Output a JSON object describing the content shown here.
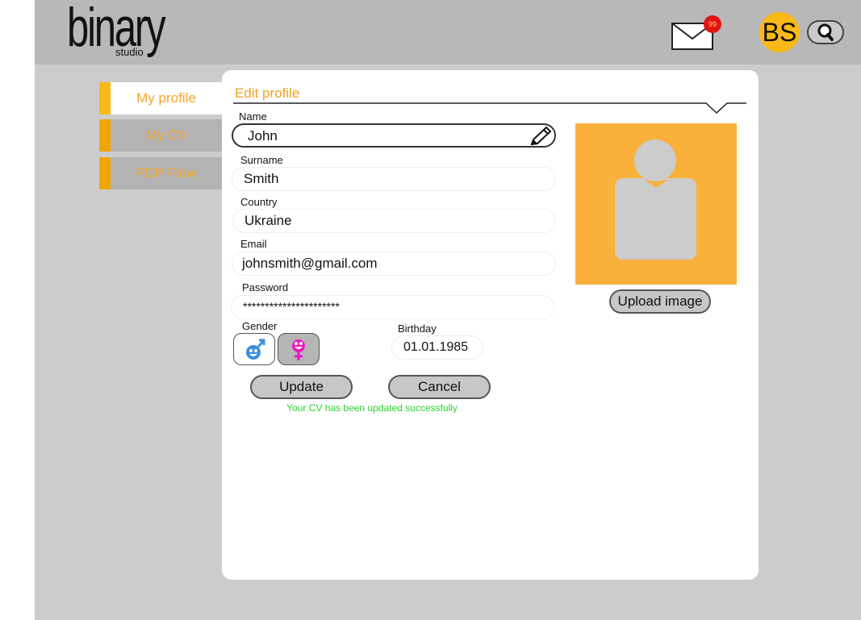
{
  "header": {
    "logo_main": "binary",
    "logo_sub": "studio",
    "mail_badge_count": "99",
    "user_initials": "BS",
    "icons": {
      "mail": "mail-icon",
      "search": "search-icon"
    }
  },
  "sidebar": {
    "items": [
      {
        "label": "My profile",
        "active": true
      },
      {
        "label": "My CV",
        "active": false
      },
      {
        "label": "PDP Flow",
        "active": false
      }
    ]
  },
  "form": {
    "title": "Edit profile",
    "name": {
      "label": "Name",
      "value": "John"
    },
    "surname": {
      "label": "Surname",
      "value": "Smith"
    },
    "country": {
      "label": "Country",
      "value": "Ukraine"
    },
    "email": {
      "label": "Email",
      "value": "johnsmith@gmail.com"
    },
    "password": {
      "label": "Password",
      "value": "**********************"
    },
    "gender": {
      "label": "Gender",
      "selected": "female",
      "options": [
        "male",
        "female"
      ]
    },
    "birthday": {
      "label": "Birthday",
      "value": "01.01.1985"
    },
    "update_label": "Update",
    "cancel_label": "Cancel",
    "success_message": "Your CV has been updated successfully"
  },
  "photo": {
    "upload_label": "Upload image"
  },
  "colors": {
    "accent": "#f0a500",
    "photo_bg": "#f9b13c",
    "success": "#29d629",
    "badge": "#e21414",
    "avatar": "#fbb917"
  }
}
